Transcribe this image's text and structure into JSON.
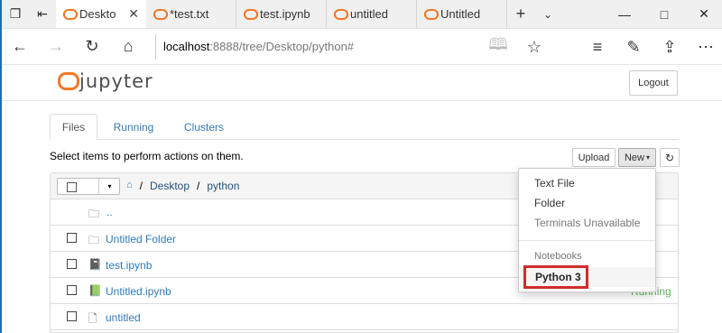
{
  "browser": {
    "tabs": [
      {
        "label": "Deskto",
        "active": true
      },
      {
        "label": "*test.txt"
      },
      {
        "label": "test.ipynb"
      },
      {
        "label": "untitled"
      },
      {
        "label": "Untitled"
      }
    ],
    "address_host": "localhost",
    "address_rest": ":8888/tree/Desktop/python#"
  },
  "jupyter": {
    "logo_text": "jupyter",
    "logout_label": "Logout",
    "tabs": [
      "Files",
      "Running",
      "Clusters"
    ],
    "instructions": "Select items to perform actions on them.",
    "upload_label": "Upload",
    "new_label": "New",
    "breadcrumb": [
      "Desktop",
      "python"
    ],
    "files": [
      {
        "name": "..",
        "type": "up"
      },
      {
        "name": "Untitled Folder",
        "type": "folder"
      },
      {
        "name": "test.ipynb",
        "type": "notebook"
      },
      {
        "name": "Untitled.ipynb",
        "type": "notebook-running",
        "status": "Running"
      },
      {
        "name": "untitled",
        "type": "file"
      }
    ],
    "new_menu": {
      "items": [
        "Text File",
        "Folder"
      ],
      "disabled_item": "Terminals Unavailable",
      "section_header": "Notebooks",
      "kernel_item": "Python 3"
    }
  },
  "colors": {
    "jupyter_orange": "#f37726",
    "link_blue": "#337ab7",
    "running_green": "#5cb85c",
    "highlight_red": "#d32b2b"
  }
}
